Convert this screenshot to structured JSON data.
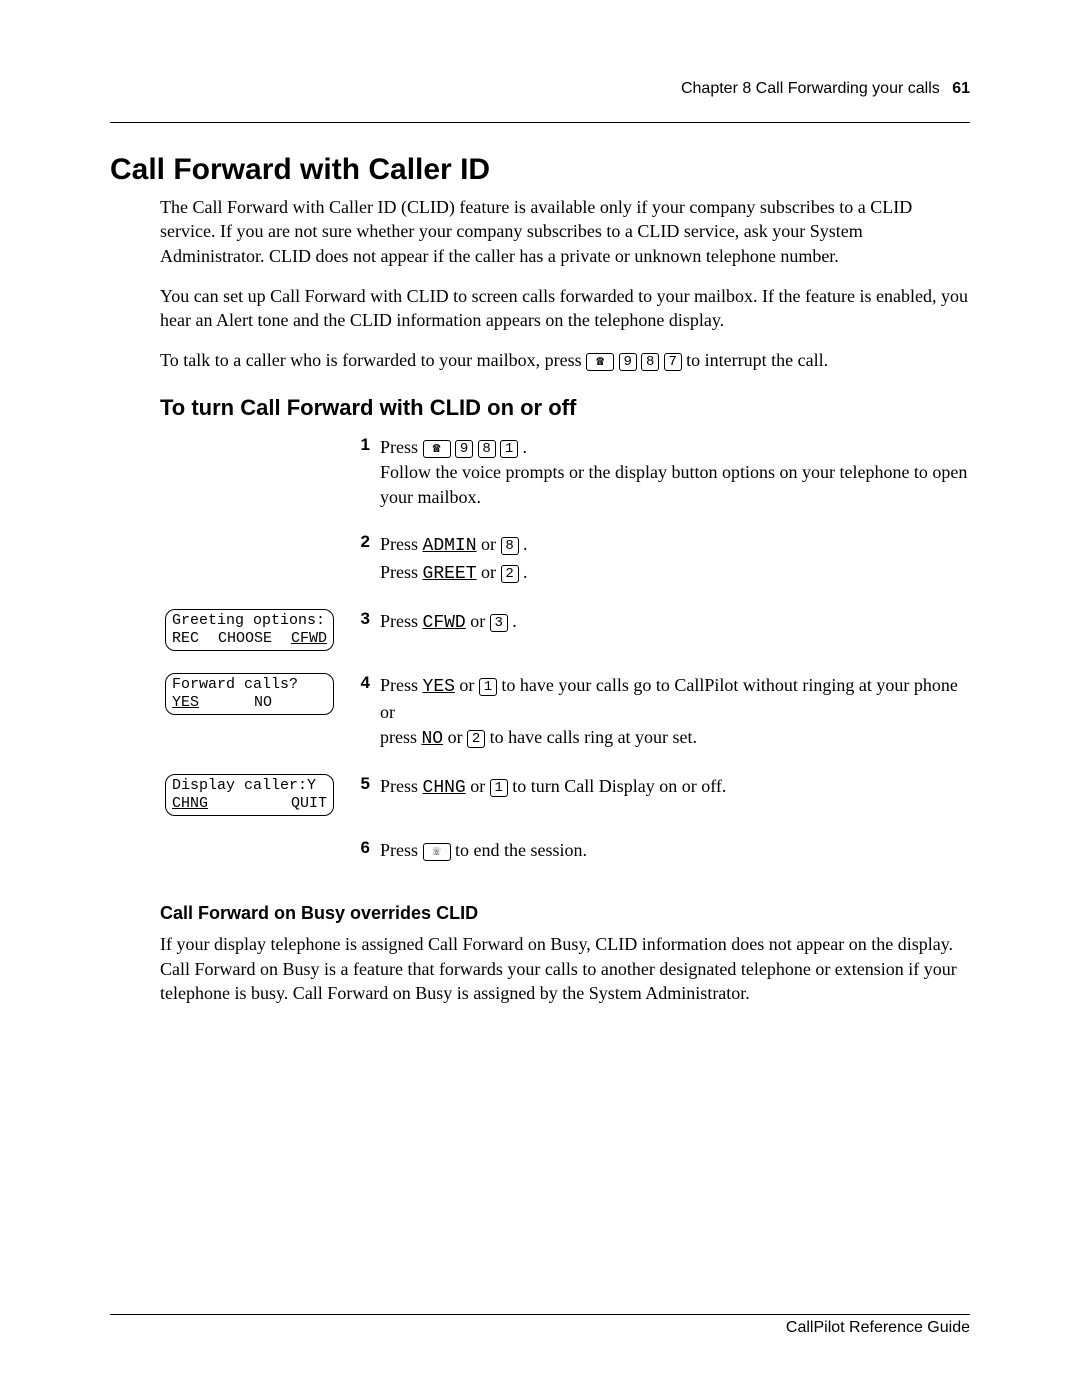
{
  "header": {
    "chapter": "Chapter 8  Call Forwarding your calls",
    "page": "61"
  },
  "h1": "Call Forward with Caller ID",
  "p1": "The Call Forward with Caller ID (CLID) feature is available only if your company subscribes to a CLID service. If you are not sure whether your company subscribes to a CLID service, ask your System Administrator. CLID does not appear if the caller has a private or unknown telephone number.",
  "p2": "You can set up Call Forward with CLID to screen calls forwarded to your mailbox. If the feature is enabled, you hear an Alert tone and the CLID information appears on the telephone display.",
  "p3a": "To talk to a caller who is forwarded to your mailbox, press ",
  "p3b": " to interrupt the call.",
  "h2": "To turn Call Forward with CLID on or off",
  "steps": {
    "s1": {
      "n": "1",
      "a": "Press ",
      "b": " .",
      "c": "Follow the voice prompts or the display button options on your telephone to open your mailbox."
    },
    "s2": {
      "n": "2",
      "a": "Press ",
      "admin": "ADMIN",
      "aor": " or ",
      "b": " .",
      "c": "Press ",
      "greet": "GREET",
      "cor": " or ",
      "d": " ."
    },
    "s3": {
      "n": "3",
      "a": "Press ",
      "cfwd": "CFWD",
      "aor": " or ",
      "b": " ."
    },
    "s4": {
      "n": "4",
      "a": "Press ",
      "yes": "YES",
      "aor": " or ",
      "b": " to have your calls go to CallPilot without ringing at your phone",
      "or": "or",
      "c": "press ",
      "no": "NO",
      "cor": " or ",
      "d": " to have calls ring at your set."
    },
    "s5": {
      "n": "5",
      "a": "Press ",
      "chng": "CHNG",
      "aor": " or ",
      "b": " to turn Call Display on or off."
    },
    "s6": {
      "n": "6",
      "a": "Press ",
      "b": " to end the session."
    }
  },
  "lcd3": {
    "line1": "Greeting options:",
    "l": "REC",
    "m": "CHOOSE",
    "r": "CFWD"
  },
  "lcd4": {
    "line1": "Forward calls?",
    "l": "YES",
    "m": "NO",
    "r": ""
  },
  "lcd5": {
    "line1": "Display caller:Y",
    "l": "CHNG",
    "m": "",
    "r": "QUIT"
  },
  "h3": "Call Forward on Busy overrides CLID",
  "p4": "If your display telephone is assigned Call Forward on Busy, CLID information does not appear on the display. Call Forward on Busy is a feature that forwards your calls to another designated telephone or extension if your telephone is busy. Call Forward on Busy is assigned by the System Administrator.",
  "footer": "CallPilot Reference Guide",
  "keys": {
    "feature": "☎",
    "k9": "9",
    "k8": "8",
    "k7": "7",
    "k1": "1",
    "k2": "2",
    "k3": "3",
    "release": "☏"
  },
  "chart_data": {
    "type": "table",
    "title": "Document page — no chart present"
  }
}
